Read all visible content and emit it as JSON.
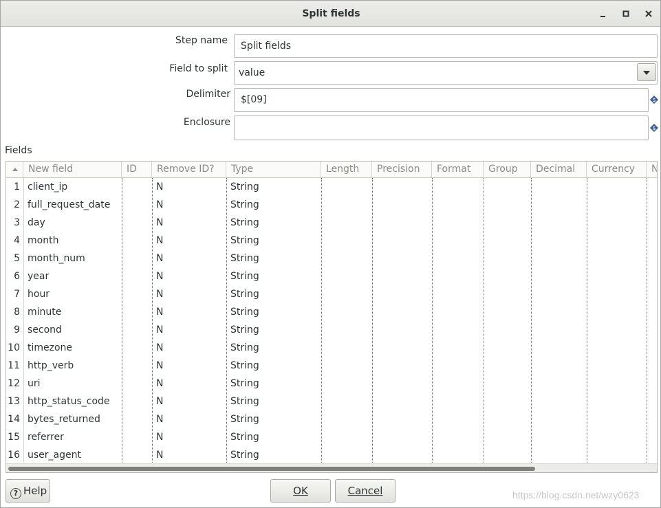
{
  "window": {
    "title": "Split fields"
  },
  "form": {
    "step_name_label": "Step name",
    "step_name_value": "Split fields",
    "field_to_split_label": "Field to split",
    "field_to_split_value": "value",
    "delimiter_label": "Delimiter",
    "delimiter_value": "$[09]",
    "enclosure_label": "Enclosure",
    "enclosure_value": ""
  },
  "fields_section": {
    "label": "Fields",
    "columns": [
      "New field",
      "ID",
      "Remove ID?",
      "Type",
      "Length",
      "Precision",
      "Format",
      "Group",
      "Decimal",
      "Currency",
      "N"
    ],
    "rows": [
      {
        "num": "1",
        "name": "client_ip",
        "id": "",
        "remove_id": "N",
        "type": "String"
      },
      {
        "num": "2",
        "name": "full_request_date",
        "id": "",
        "remove_id": "N",
        "type": "String"
      },
      {
        "num": "3",
        "name": "day",
        "id": "",
        "remove_id": "N",
        "type": "String"
      },
      {
        "num": "4",
        "name": "month",
        "id": "",
        "remove_id": "N",
        "type": "String"
      },
      {
        "num": "5",
        "name": "month_num",
        "id": "",
        "remove_id": "N",
        "type": "String"
      },
      {
        "num": "6",
        "name": "year",
        "id": "",
        "remove_id": "N",
        "type": "String"
      },
      {
        "num": "7",
        "name": "hour",
        "id": "",
        "remove_id": "N",
        "type": "String"
      },
      {
        "num": "8",
        "name": "minute",
        "id": "",
        "remove_id": "N",
        "type": "String"
      },
      {
        "num": "9",
        "name": "second",
        "id": "",
        "remove_id": "N",
        "type": "String"
      },
      {
        "num": "10",
        "name": "timezone",
        "id": "",
        "remove_id": "N",
        "type": "String"
      },
      {
        "num": "11",
        "name": "http_verb",
        "id": "",
        "remove_id": "N",
        "type": "String"
      },
      {
        "num": "12",
        "name": "uri",
        "id": "",
        "remove_id": "N",
        "type": "String"
      },
      {
        "num": "13",
        "name": "http_status_code",
        "id": "",
        "remove_id": "N",
        "type": "String"
      },
      {
        "num": "14",
        "name": "bytes_returned",
        "id": "",
        "remove_id": "N",
        "type": "String"
      },
      {
        "num": "15",
        "name": "referrer",
        "id": "",
        "remove_id": "N",
        "type": "String"
      },
      {
        "num": "16",
        "name": "user_agent",
        "id": "",
        "remove_id": "N",
        "type": "String"
      }
    ]
  },
  "buttons": {
    "help": "Help",
    "ok_underlined": "O",
    "ok_rest": "K",
    "cancel_underlined": "C",
    "cancel_rest": "ancel"
  },
  "watermark": "https://blog.csdn.net/wzy0623",
  "icons": {
    "variable": "diamond-dollar-icon",
    "dropdown": "chevron-down-icon",
    "help": "question-circle-icon",
    "sort": "sort-ascending-icon"
  },
  "colors": {
    "variable_icon": "#3a5f8c",
    "header_text": "#8b8b88"
  }
}
